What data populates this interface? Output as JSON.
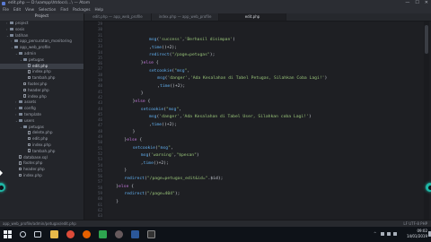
{
  "window": {
    "title": "edit.php — D:\\xampp\\htdocs\\...\\ — Atom"
  },
  "menu": [
    "File",
    "Edit",
    "View",
    "Selection",
    "Find",
    "Packages",
    "Help"
  ],
  "sidebar": {
    "header": "Project",
    "items": [
      {
        "label": "project",
        "type": "folder",
        "depth": 1,
        "arrow": "›"
      },
      {
        "label": "sosis",
        "type": "folder",
        "depth": 1,
        "arrow": "›"
      },
      {
        "label": "latihan",
        "type": "folder",
        "depth": 1,
        "arrow": "⌄"
      },
      {
        "label": "app_persuratan_monitoring",
        "type": "folder",
        "depth": 2,
        "arrow": "›"
      },
      {
        "label": "app_web_profile",
        "type": "folder",
        "depth": 2,
        "arrow": "⌄"
      },
      {
        "label": "admin",
        "type": "folder",
        "depth": 3,
        "arrow": "⌄"
      },
      {
        "label": "petugas",
        "type": "folder",
        "depth": 4,
        "arrow": "⌄"
      },
      {
        "label": "edit.php",
        "type": "file",
        "depth": 5,
        "arrow": "",
        "selected": true
      },
      {
        "label": "index.php",
        "type": "file",
        "depth": 5,
        "arrow": ""
      },
      {
        "label": "tambah.php",
        "type": "file",
        "depth": 5,
        "arrow": ""
      },
      {
        "label": "footer.php",
        "type": "file",
        "depth": 4,
        "arrow": ""
      },
      {
        "label": "header.php",
        "type": "file",
        "depth": 4,
        "arrow": ""
      },
      {
        "label": "index.php",
        "type": "file",
        "depth": 4,
        "arrow": ""
      },
      {
        "label": "assets",
        "type": "folder",
        "depth": 3,
        "arrow": "›"
      },
      {
        "label": "config",
        "type": "folder",
        "depth": 3,
        "arrow": "›"
      },
      {
        "label": "template",
        "type": "folder",
        "depth": 3,
        "arrow": "›"
      },
      {
        "label": "users",
        "type": "folder",
        "depth": 3,
        "arrow": "⌄"
      },
      {
        "label": "petugas",
        "type": "folder",
        "depth": 4,
        "arrow": "⌄"
      },
      {
        "label": "delete.php",
        "type": "file",
        "depth": 5,
        "arrow": ""
      },
      {
        "label": "edit.php",
        "type": "file",
        "depth": 5,
        "arrow": ""
      },
      {
        "label": "index.php",
        "type": "file",
        "depth": 5,
        "arrow": ""
      },
      {
        "label": "tambah.php",
        "type": "file",
        "depth": 5,
        "arrow": ""
      },
      {
        "label": "database.sql",
        "type": "file",
        "depth": 3,
        "arrow": ""
      },
      {
        "label": "footer.php",
        "type": "file",
        "depth": 3,
        "arrow": ""
      },
      {
        "label": "header.php",
        "type": "file",
        "depth": 3,
        "arrow": ""
      },
      {
        "label": "index.php",
        "type": "file",
        "depth": 3,
        "arrow": ""
      }
    ]
  },
  "tabs": [
    {
      "label": "edit.php — app_web_profile",
      "active": false
    },
    {
      "label": "index.php — app_web_profile",
      "active": false
    },
    {
      "label": "edit.php",
      "active": true
    }
  ],
  "editor": {
    "line_numbers": [
      "29",
      "30",
      "31",
      "32",
      "33",
      "34",
      "35",
      "36",
      "37",
      "38",
      "39",
      "40",
      "41",
      "42",
      "43",
      "44",
      "45",
      "46",
      "47",
      "48",
      "49",
      "50",
      "51",
      "52",
      "53",
      "54",
      "55",
      "56",
      "57",
      "58",
      "59",
      "60",
      "61",
      "62",
      "63"
    ],
    "lines": [
      {
        "indent": 0,
        "text": ""
      },
      {
        "indent": 0,
        "text": ""
      },
      {
        "indent": 10,
        "text": "msg('success','Berhasil disimpan')"
      },
      {
        "indent": 10,
        "text": ",time()+2);"
      },
      {
        "indent": 10,
        "text": "redirect(\"/page=petugas\");"
      },
      {
        "indent": 8,
        "text": "}else {"
      },
      {
        "indent": 10,
        "text": "setcookie(\"msg\","
      },
      {
        "indent": 12,
        "text": "msg('danger','Ada Kesalahan di Tabel Petugas, Silahkan Coba Lagi!')"
      },
      {
        "indent": 12,
        "text": ",time()+2);"
      },
      {
        "indent": 8,
        "text": "}"
      },
      {
        "indent": 6,
        "text": "}else {"
      },
      {
        "indent": 8,
        "text": "setcookie(\"msg\","
      },
      {
        "indent": 10,
        "text": "msg('danger','Ada Kesalahan di Tabel User, Silahkan coba Lagi!')"
      },
      {
        "indent": 10,
        "text": ",time()+2);"
      },
      {
        "indent": 6,
        "text": "}"
      },
      {
        "indent": 4,
        "text": "}else {"
      },
      {
        "indent": 6,
        "text": "setcookie(\"msg\","
      },
      {
        "indent": 8,
        "text": "msg('warning',\"$pesan\")"
      },
      {
        "indent": 8,
        "text": ",time()+2);"
      },
      {
        "indent": 4,
        "text": "}"
      },
      {
        "indent": 4,
        "text": "redirect(\"/page=petugas_edit&id=\".$id);"
      },
      {
        "indent": 2,
        "text": "}else {"
      },
      {
        "indent": 4,
        "text": "redirect(\"/page=404\");"
      },
      {
        "indent": 2,
        "text": "}"
      }
    ]
  },
  "statusbar": {
    "path": "app_web_profile/admin/petugas/edit.php",
    "right": "LF  UTF-8  PHP"
  },
  "taskbar": {
    "time": "09:02",
    "date": "14/01/2019"
  },
  "colors": {
    "accent": "#1fb5a4",
    "keyword": "#c678dd",
    "string": "#98c379",
    "func": "#61afef",
    "paren": "#d19a66"
  }
}
